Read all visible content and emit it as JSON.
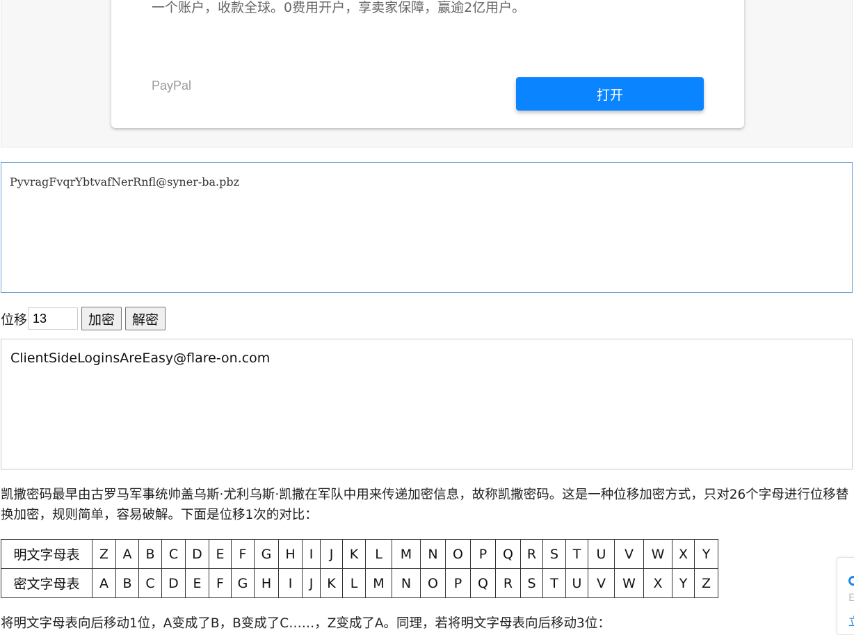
{
  "ad": {
    "description": "一个账户，收款全球。0费用开户，享卖家保障，赢逾2亿用户。",
    "brand": "PayPal",
    "open_button": "打开"
  },
  "cipher": {
    "input_text": "PyvragFvqrYbtvafNerRnfl@syner-ba.pbz",
    "shift_label": "位移",
    "shift_value": "13",
    "encrypt_button": "加密",
    "decrypt_button": "解密",
    "output_text": "ClientSideLoginsAreEasy@flare-on.com"
  },
  "article": {
    "paragraph1": "凯撒密码最早由古罗马军事统帅盖乌斯·尤利乌斯·凯撒在军队中用来传递加密信息，故称凯撒密码。这是一种位移加密方式，只对26个字母进行位移替换加密，规则简单，容易破解。下面是位移1次的对比：",
    "table": {
      "plain_label": "明文字母表",
      "cipher_label": "密文字母表",
      "plain": [
        "Z",
        "A",
        "B",
        "C",
        "D",
        "E",
        "F",
        "G",
        "H",
        "I",
        "J",
        "K",
        "L",
        "M",
        "N",
        "O",
        "P",
        "Q",
        "R",
        "S",
        "T",
        "U",
        "V",
        "W",
        "X",
        "Y"
      ],
      "cipher": [
        "A",
        "B",
        "C",
        "D",
        "E",
        "F",
        "G",
        "H",
        "I",
        "J",
        "K",
        "L",
        "M",
        "N",
        "O",
        "P",
        "Q",
        "R",
        "S",
        "T",
        "U",
        "V",
        "W",
        "X",
        "Y",
        "Z"
      ]
    },
    "paragraph2": "将明文字母表向后移动1位，A变成了B，B变成了C……，Z变成了A。同理，若将明文字母表向后移动3位："
  },
  "side_widget": {
    "icon": "circle-icon",
    "text1": "E",
    "text2": "立"
  }
}
